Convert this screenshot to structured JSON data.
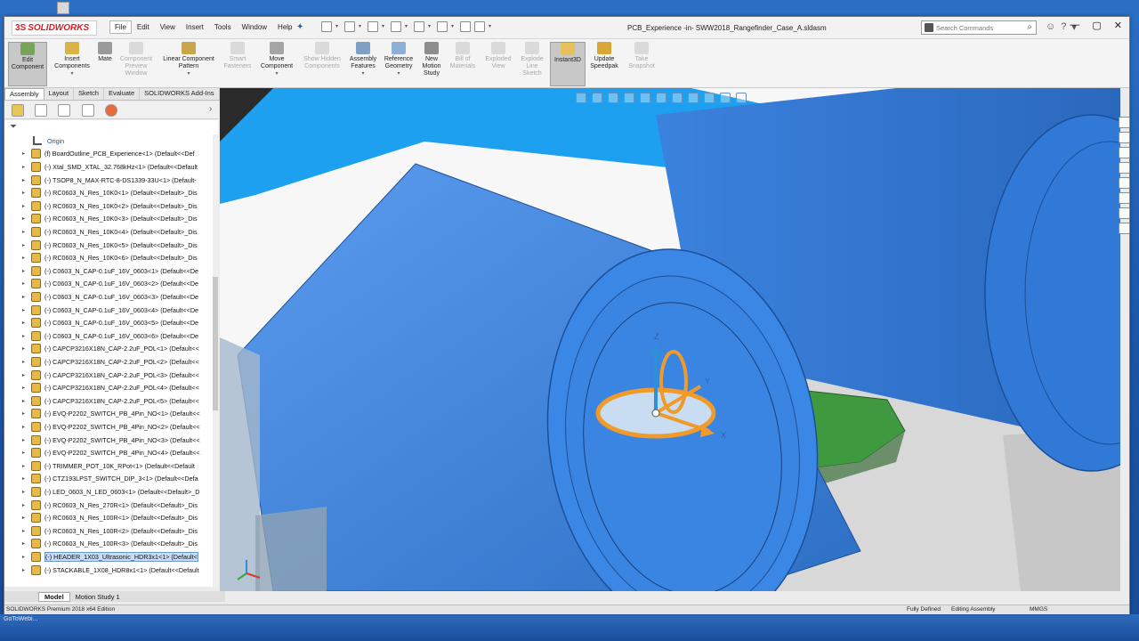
{
  "window": {
    "app_name": "SOLIDWORKS",
    "document_title": "PCB_Experience -in- SWW2018_Rangefinder_Case_A.sldasm",
    "search_placeholder": "Search Commands"
  },
  "menu": [
    "File",
    "Edit",
    "View",
    "Insert",
    "Tools",
    "Window",
    "Help"
  ],
  "ribbon": [
    {
      "label": "Edit Component",
      "state": "selected"
    },
    {
      "label": "Insert Components",
      "state": "enabled"
    },
    {
      "label": "Mate",
      "state": "enabled"
    },
    {
      "label": "Component Preview Window",
      "state": "disabled"
    },
    {
      "label": "Linear Component Pattern",
      "state": "enabled"
    },
    {
      "label": "Smart Fasteners",
      "state": "disabled"
    },
    {
      "label": "Move Component",
      "state": "enabled"
    },
    {
      "label": "Show Hidden Components",
      "state": "disabled"
    },
    {
      "label": "Assembly Features",
      "state": "enabled"
    },
    {
      "label": "Reference Geometry",
      "state": "enabled"
    },
    {
      "label": "New Motion Study",
      "state": "enabled"
    },
    {
      "label": "Bill of Materials",
      "state": "disabled"
    },
    {
      "label": "Exploded View",
      "state": "disabled"
    },
    {
      "label": "Explode Line Sketch",
      "state": "disabled"
    },
    {
      "label": "Instant3D",
      "state": "selected"
    },
    {
      "label": "Update Speedpak",
      "state": "enabled"
    },
    {
      "label": "Take Snapshot",
      "state": "disabled"
    }
  ],
  "cm_tabs": [
    "Assembly",
    "Layout",
    "Sketch",
    "Evaluate",
    "SOLIDWORKS Add-Ins"
  ],
  "tree": {
    "origin": "Origin",
    "items": [
      "(f) BoardOutline_PCB_Experience<1> (Default<<Def",
      "(-) Xtal_SMD_XTAL_32.768kHz<1> (Default<<Default",
      "(-) TSOP8_N_MAX-RTC-8-DS1339-33U<1> (Default-",
      "(-) RC0603_N_Res_10K0<1> (Default<<Default>_Dis",
      "(-) RC0603_N_Res_10K0<2> (Default<<Default>_Dis",
      "(-) RC0603_N_Res_10K0<3> (Default<<Default>_Dis",
      "(-) RC0603_N_Res_10K0<4> (Default<<Default>_Dis",
      "(-) RC0603_N_Res_10K0<5> (Default<<Default>_Dis",
      "(-) RC0603_N_Res_10K0<6> (Default<<Default>_Dis",
      "(-) C0603_N_CAP-0.1uF_16V_0603<1> (Default<<De",
      "(-) C0603_N_CAP-0.1uF_16V_0603<2> (Default<<De",
      "(-) C0603_N_CAP-0.1uF_16V_0603<3> (Default<<De",
      "(-) C0603_N_CAP-0.1uF_16V_0603<4> (Default<<De",
      "(-) C0603_N_CAP-0.1uF_16V_0603<5> (Default<<De",
      "(-) C0603_N_CAP-0.1uF_16V_0603<6> (Default<<De",
      "(-) CAPCP3216X18N_CAP-2.2uF_POL<1> (Default<<",
      "(-) CAPCP3216X18N_CAP-2.2uF_POL<2> (Default<<",
      "(-) CAPCP3216X18N_CAP-2.2uF_POL<3> (Default<<",
      "(-) CAPCP3216X18N_CAP-2.2uF_POL<4> (Default<<",
      "(-) CAPCP3216X18N_CAP-2.2uF_POL<5> (Default<<",
      "(-) EVQ-P2202_SWITCH_PB_4Pin_NO<1> (Default<<",
      "(-) EVQ-P2202_SWITCH_PB_4Pin_NO<2> (Default<<",
      "(-) EVQ-P2202_SWITCH_PB_4Pin_NO<3> (Default<<",
      "(-) EVQ-P2202_SWITCH_PB_4Pin_NO<4> (Default<<",
      "(-) TRIMMER_POT_10K_RPot<1> (Default<<Default",
      "(-) CTZ193LPST_SWITCH_DIP_3<1> (Default<<Defa",
      "(-) LED_0603_N_LED_0603<1> (Default<<Default>_D",
      "(-) RC0603_N_Res_270R<1> (Default<<Default>_Dis",
      "(-) RC0603_N_Res_100R<1> (Default<<Default>_Dis",
      "(-) RC0603_N_Res_100R<2> (Default<<Default>_Dis",
      "(-) RC0603_N_Res_100R<3> (Default<<Default>_Dis",
      "(-) HEADER_1X03_Ultrasonic_HDR3x1<1> (Default<",
      "(-) STACKABLE_1X08_HDR8x1<1> (Default<<Default"
    ],
    "selected_index": 31
  },
  "bottom_tabs": [
    "Model",
    "Motion Study 1"
  ],
  "status": {
    "edition": "SOLIDWORKS Premium 2018 x64 Edition",
    "defined": "Fully Defined",
    "mode": "Editing Assembly",
    "units": "MMGS"
  },
  "taskbar_label": "GoToWebi...",
  "triad_labels": {
    "z": "Z",
    "y": "Y",
    "x": "X"
  },
  "colors": {
    "part_blue": "#3a87e6",
    "part_blue_dark": "#2d6fc4",
    "triad_orange": "#f09a2a",
    "pcb_green": "#3f9a3f"
  }
}
